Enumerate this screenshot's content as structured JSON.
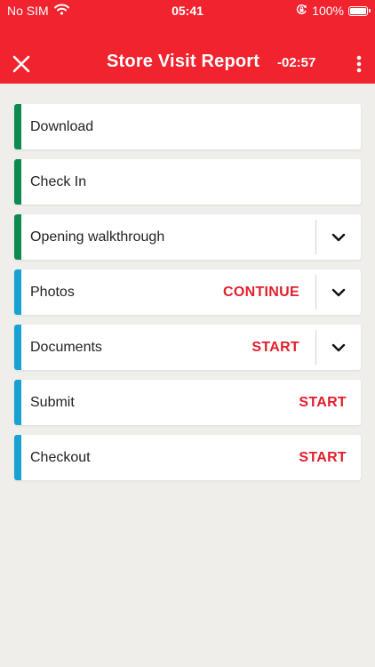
{
  "status_bar": {
    "carrier": "No SIM",
    "time": "05:41",
    "battery": "100%",
    "battery_level": 1.0
  },
  "nav": {
    "title": "Store Visit Report",
    "timer": "-02:57",
    "close_icon": "close-icon",
    "more_icon": "more-vertical-icon"
  },
  "colors": {
    "header": "#f0232f",
    "background": "#efeeea",
    "action_text": "#e41e2b",
    "stripe_complete": "#0d8a4f",
    "stripe_pending": "#17a2d3"
  },
  "items": [
    {
      "label": "Download",
      "action": "",
      "status": "complete"
    },
    {
      "label": "Check In",
      "action": "",
      "status": "complete"
    },
    {
      "label": "Opening walkthrough",
      "action": "",
      "status": "complete"
    },
    {
      "label": "Photos",
      "action": "CONTINUE",
      "status": "pending"
    },
    {
      "label": "Documents",
      "action": "START",
      "status": "pending"
    },
    {
      "label": "Submit",
      "action": "START",
      "status": "pending"
    },
    {
      "label": "Checkout",
      "action": "START",
      "status": "pending"
    }
  ]
}
